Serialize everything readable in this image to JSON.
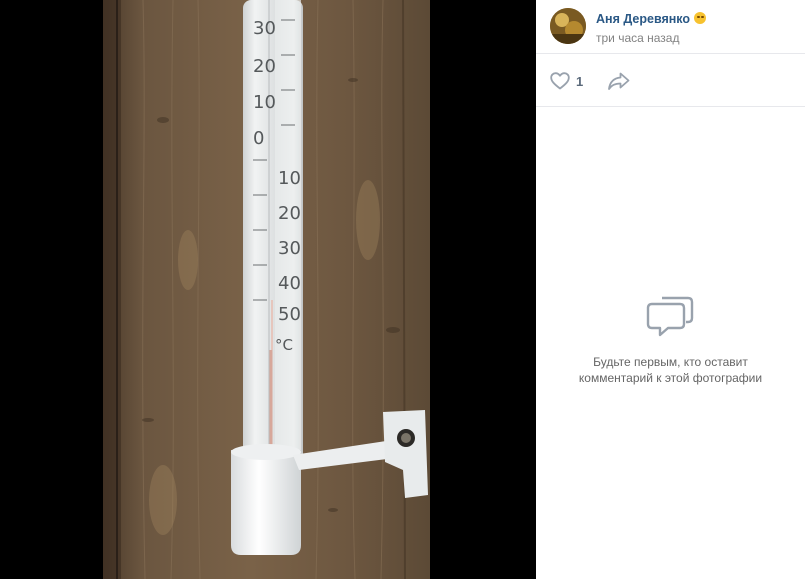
{
  "post": {
    "author_name": "Аня Деревянко",
    "time": "три часа назад",
    "likes": "1"
  },
  "photo": {
    "scale_upper": [
      "30",
      "20",
      "10",
      "0"
    ],
    "scale_lower": [
      "10",
      "20",
      "30",
      "40",
      "50"
    ],
    "unit": "°C"
  },
  "comments": {
    "empty_text": "Будьте первым, кто оставит комментарий к этой фотографии"
  },
  "icons": {
    "like": "heart-icon",
    "share": "share-arrow-icon",
    "comments_empty": "comment-bubbles-icon",
    "author_status": "smile-emoji-icon"
  },
  "colors": {
    "author_link": "#2a5885",
    "secondary_text": "#828282",
    "icon": "#99a2ad",
    "divider": "#e7e8ec"
  }
}
